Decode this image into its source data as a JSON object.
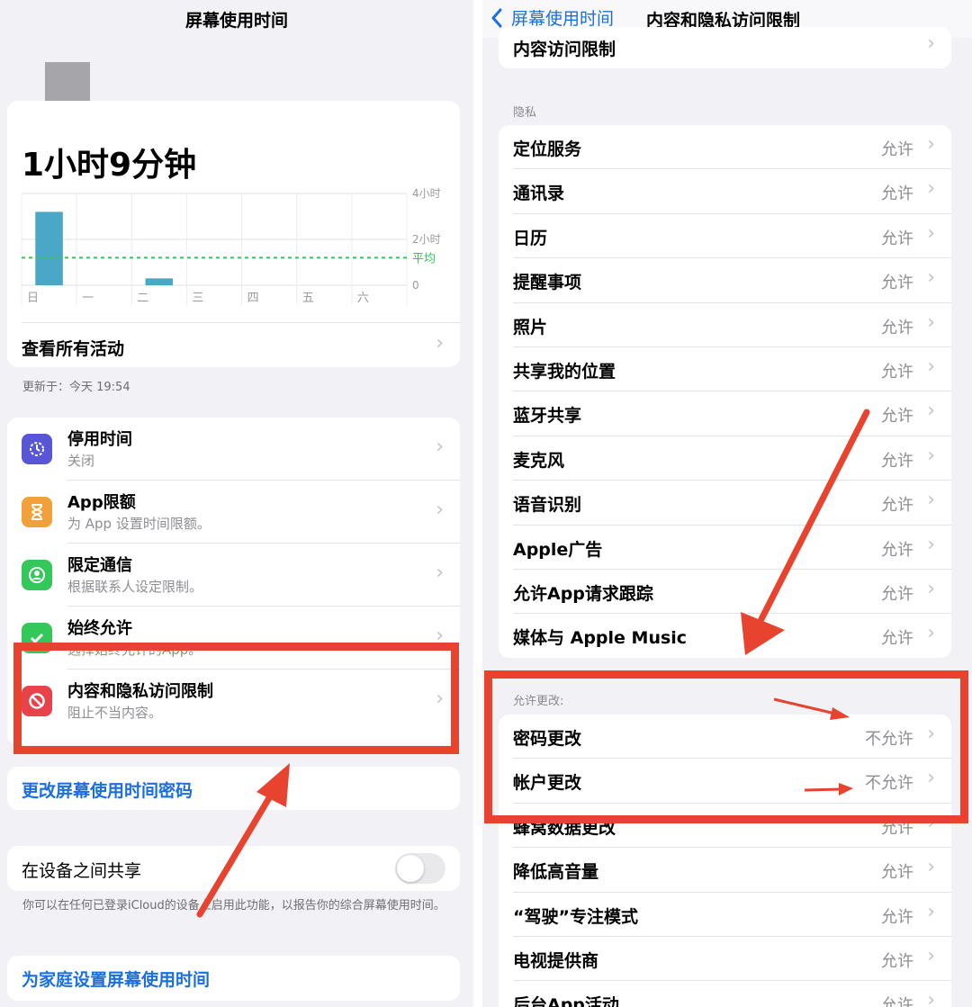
{
  "left": {
    "nav_title": "屏幕使用时间",
    "total_time": "1小时9分钟",
    "chart_data": {
      "type": "bar",
      "categories": [
        "日",
        "一",
        "二",
        "三",
        "四",
        "五",
        "六"
      ],
      "values": [
        3.2,
        0,
        0.3,
        0,
        0,
        0,
        0
      ],
      "ylim": [
        0,
        4
      ],
      "y_ticks": [
        "4小时",
        "2小时",
        "0"
      ],
      "average_label": "平均",
      "average_value": 1.2,
      "bar_color": "#4aa8c6",
      "average_color": "#34c759"
    },
    "see_all": "查看所有活动",
    "updated": "更新于：今天 19:54",
    "items": [
      {
        "title": "停用时间",
        "sub": "关闭",
        "icon_color": "#5856d6"
      },
      {
        "title": "App限额",
        "sub": "为 App 设置时间限额。",
        "icon_color": "#f2a13a"
      },
      {
        "title": "限定通信",
        "sub": "根据联系人设定限制。",
        "icon_color": "#34c759"
      },
      {
        "title": "始终允许",
        "sub": "选择始终允许的App。",
        "icon_color": "#34c759"
      },
      {
        "title": "内容和隐私访问限制",
        "sub": "阻止不当内容。",
        "icon_color": "#e8434a"
      }
    ],
    "change_passcode": "更改屏幕使用时间密码",
    "share_label": "在设备之间共享",
    "share_note": "你可以在任何已登录iCloud的设备上启用此功能，以报告你的综合屏幕使用时间。",
    "family_link": "为家庭设置屏幕使用时间"
  },
  "right": {
    "back_label": "屏幕使用时间",
    "nav_title": "内容和隐私访问限制",
    "top_row": "内容访问限制",
    "privacy_header": "隐私",
    "privacy_items": [
      {
        "label": "定位服务",
        "value": "允许"
      },
      {
        "label": "通讯录",
        "value": "允许"
      },
      {
        "label": "日历",
        "value": "允许"
      },
      {
        "label": "提醒事项",
        "value": "允许"
      },
      {
        "label": "照片",
        "value": "允许"
      },
      {
        "label": "共享我的位置",
        "value": "允许"
      },
      {
        "label": "蓝牙共享",
        "value": "允许"
      },
      {
        "label": "麦克风",
        "value": "允许"
      },
      {
        "label": "语音识别",
        "value": "允许"
      },
      {
        "label": "Apple广告",
        "value": "允许"
      },
      {
        "label": "允许App请求跟踪",
        "value": "允许"
      },
      {
        "label": "媒体与 Apple Music",
        "value": "允许"
      }
    ],
    "changes_header": "允许更改:",
    "changes_items": [
      {
        "label": "密码更改",
        "value": "不允许"
      },
      {
        "label": "帐户更改",
        "value": "不允许"
      },
      {
        "label": "蜂窝数据更改",
        "value": "允许"
      },
      {
        "label": "降低高音量",
        "value": "允许"
      },
      {
        "label": "“驾驶”专注模式",
        "value": "允许"
      },
      {
        "label": "电视提供商",
        "value": "允许"
      },
      {
        "label": "后台App活动",
        "value": "允许"
      }
    ]
  },
  "colors": {
    "annotation_red": "#e8432f",
    "link_blue": "#1a6fe0"
  }
}
